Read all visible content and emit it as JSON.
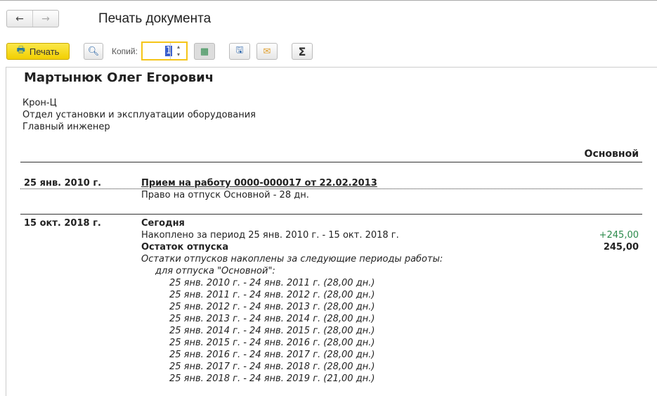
{
  "nav": {
    "back": "←",
    "forward": "→"
  },
  "window_title": "Печать документа",
  "toolbar": {
    "print_label": "Печать",
    "copies_label": "Копий:",
    "copies_value": "1",
    "spin_up": "▴",
    "spin_down": "▾",
    "sum_label": "Σ"
  },
  "doc": {
    "name": "Мартынюк Олег Егорович",
    "org": "Крон-Ц",
    "dept": "Отдел установки и эксплуатации оборудования",
    "position": "Главный инженер",
    "column_header": "Основной",
    "entry1": {
      "date": "25 янв. 2010 г.",
      "title": "Прием на работу 0000-000017 от 22.02.2013",
      "detail": "Право на отпуск Основной - 28 дн."
    },
    "entry2": {
      "date": "15 окт. 2018 г.",
      "title": "Сегодня",
      "accrued": "Накоплено за период 25 янв. 2010 г. - 15 окт. 2018 г.",
      "accrued_value": "+245,00",
      "balance_label": "Остаток отпуска",
      "balance_value": "245,00",
      "periods_intro": "Остатки отпусков накоплены за следующие периоды работы:",
      "for_vacation": "для отпуска \"Основной\":",
      "periods": [
        "25 янв. 2010 г. - 24 янв. 2011 г. (28,00 дн.)",
        "25 янв. 2011 г. - 24 янв. 2012 г. (28,00 дн.)",
        "25 янв. 2012 г. - 24 янв. 2013 г. (28,00 дн.)",
        "25 янв. 2013 г. - 24 янв. 2014 г. (28,00 дн.)",
        "25 янв. 2014 г. - 24 янв. 2015 г. (28,00 дн.)",
        "25 янв. 2015 г. - 24 янв. 2016 г. (28,00 дн.)",
        "25 янв. 2016 г. - 24 янв. 2017 г. (28,00 дн.)",
        "25 янв. 2017 г. - 24 янв. 2018 г. (28,00 дн.)",
        "25 янв. 2018 г. - 24 янв. 2019 г. (21,00 дн.)"
      ]
    }
  },
  "colors": {
    "positive": "#2a8a4a",
    "accent": "#f5c518"
  }
}
